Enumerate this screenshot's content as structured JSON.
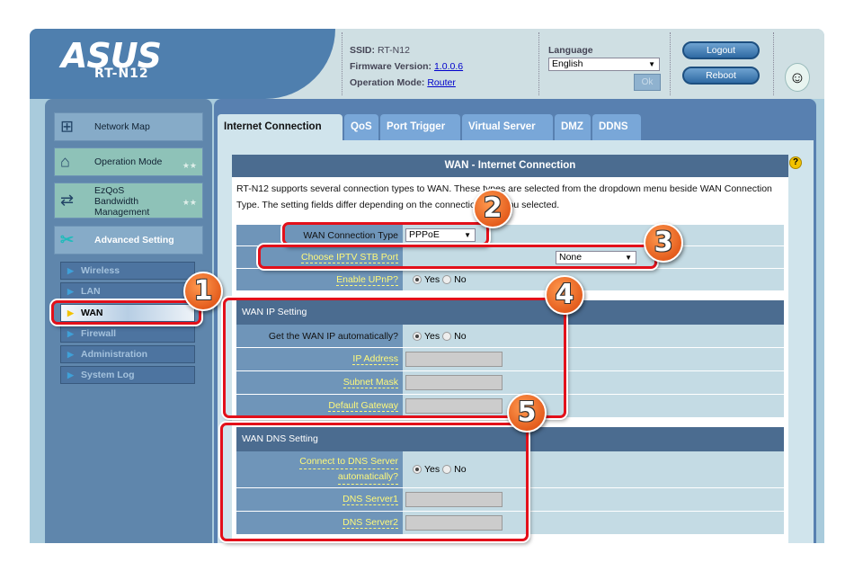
{
  "header": {
    "brand": "ASUS",
    "model": "RT-N12",
    "ssid_label": "SSID:",
    "ssid": "RT-N12",
    "firmware_label": "Firmware Version:",
    "firmware": "1.0.0.6",
    "opmode_label": "Operation Mode:",
    "opmode": "Router",
    "language_label": "Language",
    "language": "English",
    "ok": "Ok",
    "logout": "Logout",
    "reboot": "Reboot"
  },
  "sidebar": {
    "main": [
      {
        "label": "Network Map",
        "icon": "network-map-icon"
      },
      {
        "label": "Operation Mode",
        "icon": "router-icon"
      },
      {
        "label": "EzQoS Bandwidth Management",
        "icon": "bandwidth-icon"
      },
      {
        "label": "Advanced Setting",
        "icon": "tools-icon"
      }
    ],
    "sub": [
      "Wireless",
      "LAN",
      "WAN",
      "Firewall",
      "Administration",
      "System Log"
    ],
    "active": "WAN"
  },
  "tabs": [
    "Internet Connection",
    "QoS",
    "Port Trigger",
    "Virtual Server",
    "DMZ",
    "DDNS"
  ],
  "panel": {
    "title": "WAN - Internet Connection",
    "description": "RT-N12 supports several connection types to WAN. These types are selected from the dropdown menu beside WAN Connection Type. The setting fields differ depending on the connection type you selected.",
    "wan_type_label": "WAN Connection Type",
    "wan_type": "PPPoE",
    "iptv_label": "Choose IPTV STB Port",
    "iptv": "None",
    "upnp_label": "Enable UPnP?",
    "yes": "Yes",
    "no": "No",
    "ip_section": "WAN IP Setting",
    "ip_auto_label": "Get the WAN IP automatically?",
    "ip_address": "IP Address",
    "subnet": "Subnet Mask",
    "gateway": "Default Gateway",
    "dns_section": "WAN DNS Setting",
    "dns_auto_l1": "Connect to DNS Server",
    "dns_auto_l2": "automatically?",
    "dns1": "DNS Server1",
    "dns2": "DNS Server2"
  },
  "callouts": [
    "1",
    "2",
    "3",
    "4",
    "5"
  ],
  "colors": {
    "callout": "#e3101a",
    "header_bar": "#4b6c90",
    "label_link": "#fff97a"
  }
}
